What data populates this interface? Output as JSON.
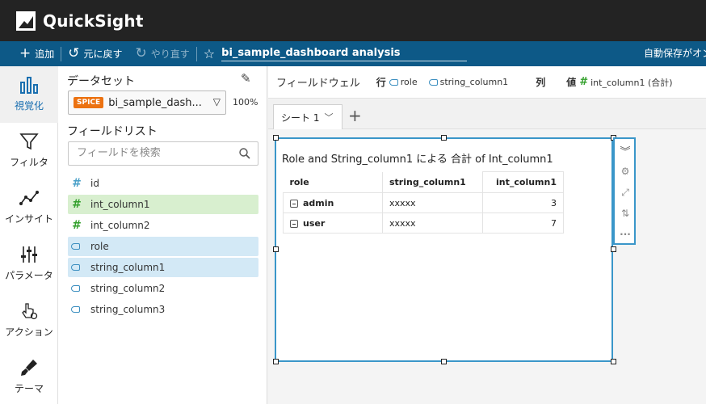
{
  "app": {
    "title": "QuickSight"
  },
  "toolbar": {
    "add_label": "追加",
    "undo_label": "元に戻す",
    "redo_label": "やり直す",
    "analysis_name": "bi_sample_dashboard analysis",
    "autosave_label": "自動保存がオン"
  },
  "leftnav": {
    "items": [
      {
        "label": "視覚化",
        "icon": "bar-chart-icon",
        "active": true
      },
      {
        "label": "フィルタ",
        "icon": "filter-icon"
      },
      {
        "label": "インサイト",
        "icon": "insights-icon"
      },
      {
        "label": "パラメータ",
        "icon": "parameters-icon"
      },
      {
        "label": "アクション",
        "icon": "actions-icon"
      },
      {
        "label": "テーマ",
        "icon": "theme-brush-icon"
      }
    ]
  },
  "fields_panel": {
    "dataset_title": "データセット",
    "dataset_badge": "SPICE",
    "dataset_name": "bi_sample_dash...",
    "dataset_percent": "100%",
    "field_list_title": "フィールドリスト",
    "search_placeholder": "フィールドを検索",
    "fields": [
      {
        "name": "id",
        "type": "measure",
        "selected": false
      },
      {
        "name": "int_column1",
        "type": "measure",
        "selected": true
      },
      {
        "name": "int_column2",
        "type": "measure",
        "selected": false
      },
      {
        "name": "role",
        "type": "dimension",
        "selected": true
      },
      {
        "name": "string_column1",
        "type": "dimension",
        "selected": true
      },
      {
        "name": "string_column2",
        "type": "dimension",
        "selected": false
      },
      {
        "name": "string_column3",
        "type": "dimension",
        "selected": false
      }
    ]
  },
  "field_wells": {
    "title": "フィールドウェル",
    "rows_label": "行",
    "rows": [
      "role",
      "string_column1"
    ],
    "columns_label": "列",
    "values_label": "値",
    "values": [
      "int_column1 (合計)"
    ]
  },
  "sheets": {
    "tabs": [
      {
        "label": "シート 1"
      }
    ]
  },
  "visual": {
    "title": "Role and String_column1 による 合計 of Int_column1",
    "table": {
      "headers": [
        "role",
        "string_column1",
        "int_column1"
      ],
      "rows": [
        {
          "role": "admin",
          "string_column1": "xxxxx",
          "int_column1": "3"
        },
        {
          "role": "user",
          "string_column1": "xxxxx",
          "int_column1": "7"
        }
      ]
    }
  },
  "colors": {
    "titlebar": "#232323",
    "toolbar": "#0d5987",
    "accent": "#3a96c9",
    "spice": "#ec7211",
    "measure_selected": "#d8efcf",
    "dimension_selected": "#d3e9f6"
  }
}
